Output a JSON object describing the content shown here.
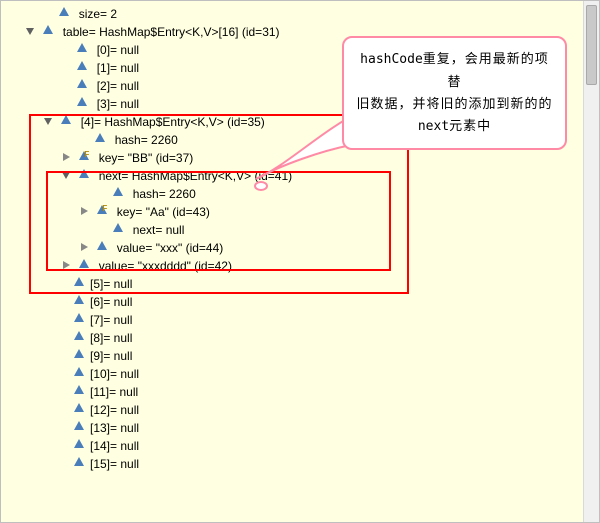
{
  "callout": {
    "line1_prefix": "hashCode",
    "line1_rest": "重复，会用最新的项替",
    "line2": "旧数据，并将旧的添加到新的的",
    "line3_prefix": "next",
    "line3_rest": "元素中"
  },
  "tree": {
    "size": {
      "name": "size",
      "eq": "=",
      "value": "2"
    },
    "table": {
      "name": "table",
      "eq": "=",
      "type": "HashMap$Entry<K,V>[16]",
      "id": "(id=31)"
    },
    "entries": {
      "n0": "[0]= null",
      "n1": "[1]= null",
      "n2": "[2]= null",
      "n3": "[3]= null",
      "n5": "[5]= null",
      "n6": "[6]= null",
      "n7": "[7]= null",
      "n8": "[8]= null",
      "n9": "[9]= null",
      "n10": "[10]= null",
      "n11": "[11]= null",
      "n12": "[12]= null",
      "n13": "[13]= null",
      "n14": "[14]= null",
      "n15": "[15]= null"
    },
    "e4": {
      "label": "[4]= HashMap$Entry<K,V>  (id=35)",
      "hash": "hash= 2260",
      "key": "key= \"BB\" (id=37)",
      "value": "value= \"xxxdddd\" (id=42)",
      "next": {
        "label": "next= HashMap$Entry<K,V>  (id=41)",
        "hash": "hash= 2260",
        "key": "key= \"Aa\" (id=43)",
        "nextnull": "next= null",
        "value": "value= \"xxx\" (id=44)"
      }
    }
  }
}
